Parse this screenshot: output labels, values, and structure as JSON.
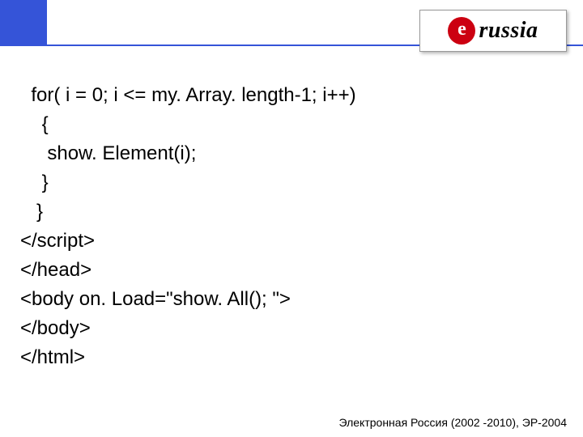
{
  "logo": {
    "text": "russia",
    "badge_letter": "e"
  },
  "code": {
    "l1": "  for( i = 0; i <= my. Array. length-1; i++)",
    "l2": "    {",
    "l3": "     show. Element(i);",
    "l4": "    }",
    "l5": "   }",
    "l6": "</script>",
    "l7": "</head>",
    "l8": "<body on. Load=\"show. All(); \">",
    "l9": "</body>",
    "l10": "</html>"
  },
  "footer": "Электронная Россия (2002 -2010), ЭР-2004"
}
